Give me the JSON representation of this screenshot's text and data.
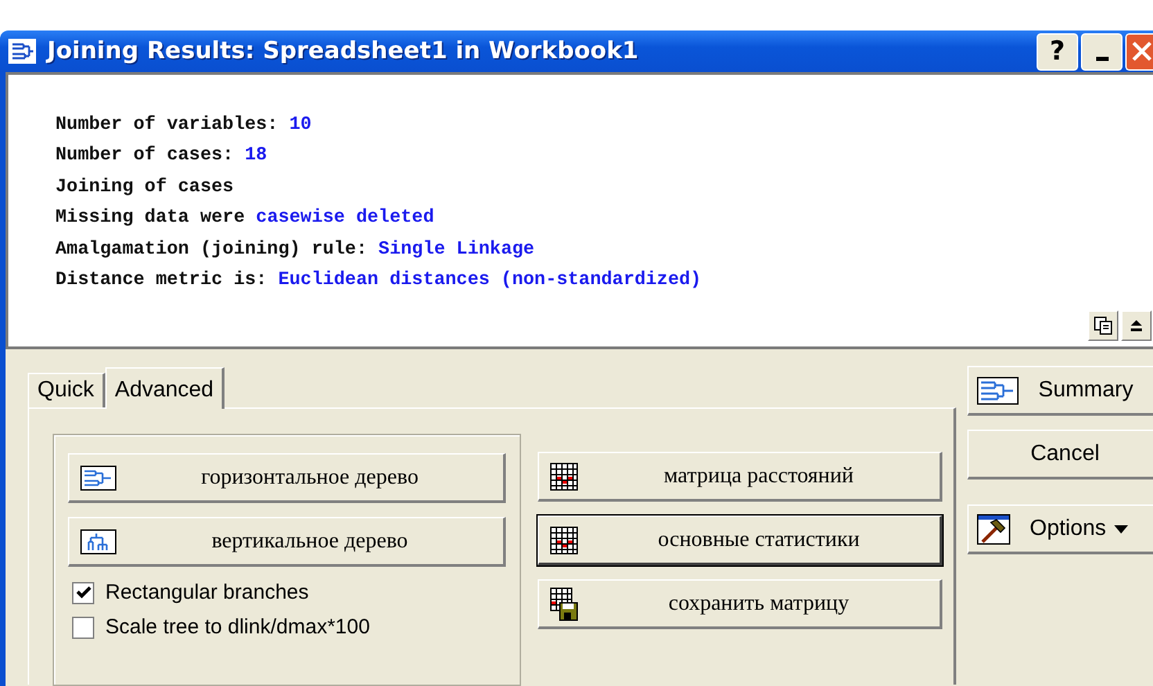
{
  "window": {
    "title": "Joining Results: Spreadsheet1 in Workbook1"
  },
  "title_buttons": [
    {
      "kind": "help",
      "label": "?"
    },
    {
      "kind": "minimize"
    },
    {
      "kind": "close"
    }
  ],
  "output": {
    "lines": [
      {
        "label": "Number of variables: ",
        "value": "10"
      },
      {
        "label": "Number of cases: ",
        "value": "18"
      },
      {
        "label": "Joining of cases"
      },
      {
        "label": "Missing data were ",
        "value": "casewise deleted"
      },
      {
        "label": "Amalgamation (joining) rule: ",
        "value": "Single Linkage"
      },
      {
        "label": "Distance metric is: ",
        "value": "Euclidean distances (non-standardized)"
      }
    ]
  },
  "tabs": [
    {
      "label": "Quick",
      "selected": false
    },
    {
      "label": "Advanced",
      "selected": true
    }
  ],
  "tree_buttons": [
    {
      "label": "горизонтальное дерево",
      "kind": "horizontal"
    },
    {
      "label": "вертикальное дерево",
      "kind": "vertical"
    }
  ],
  "checkboxes": [
    {
      "label": "Rectangular branches",
      "checked": true
    },
    {
      "label": "Scale tree to dlink/dmax*100",
      "checked": false
    }
  ],
  "matrix_buttons": [
    {
      "label": "матрица расстояний",
      "kind": "matrix",
      "default": false
    },
    {
      "label": "основные статистики",
      "kind": "matrix",
      "default": true
    },
    {
      "label": "сохранить матрицу",
      "kind": "save",
      "default": false
    }
  ],
  "side_buttons": [
    {
      "label": "Summary",
      "kind": "tree"
    },
    {
      "label": "Cancel",
      "kind": "plain"
    },
    {
      "label": "Options",
      "kind": "menu"
    }
  ]
}
